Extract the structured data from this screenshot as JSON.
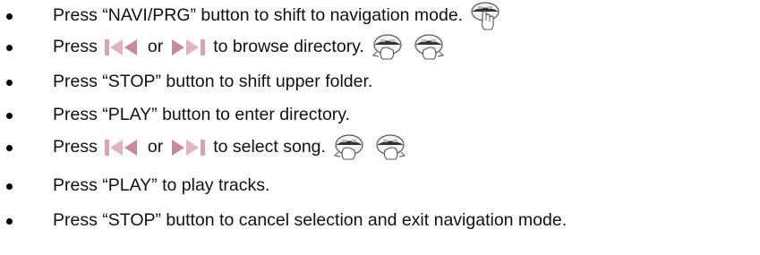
{
  "steps": [
    {
      "before": "Press “NAVI/PRG” button to shift to navigation mode.",
      "icons": [
        "hand-press-icon"
      ]
    },
    {
      "before": "Press",
      "prev_icon": "skip-back-icon",
      "middle": "or",
      "next_icon": "skip-forward-icon",
      "after": "to browse directory.",
      "icons": [
        "hand-rotate-left-icon",
        "hand-rotate-right-icon"
      ]
    },
    {
      "before": "Press “STOP” button to shift upper folder."
    },
    {
      "before": "Press “PLAY” button to enter directory."
    },
    {
      "before": "Press",
      "prev_icon": "skip-back-icon",
      "middle": "or",
      "next_icon": "skip-forward-icon",
      "after": "to select song.",
      "icons": [
        "hand-rotate-left-icon",
        "hand-rotate-right-icon"
      ]
    },
    {
      "before": "Press “PLAY” to play tracks."
    },
    {
      "before": "Press “STOP” button to cancel selection and exit navigation mode."
    }
  ],
  "colors": {
    "text": "#111111",
    "skip_icon_light": "#e4b8c4",
    "skip_icon_dark": "#c48294",
    "hand_outline": "#555555"
  }
}
